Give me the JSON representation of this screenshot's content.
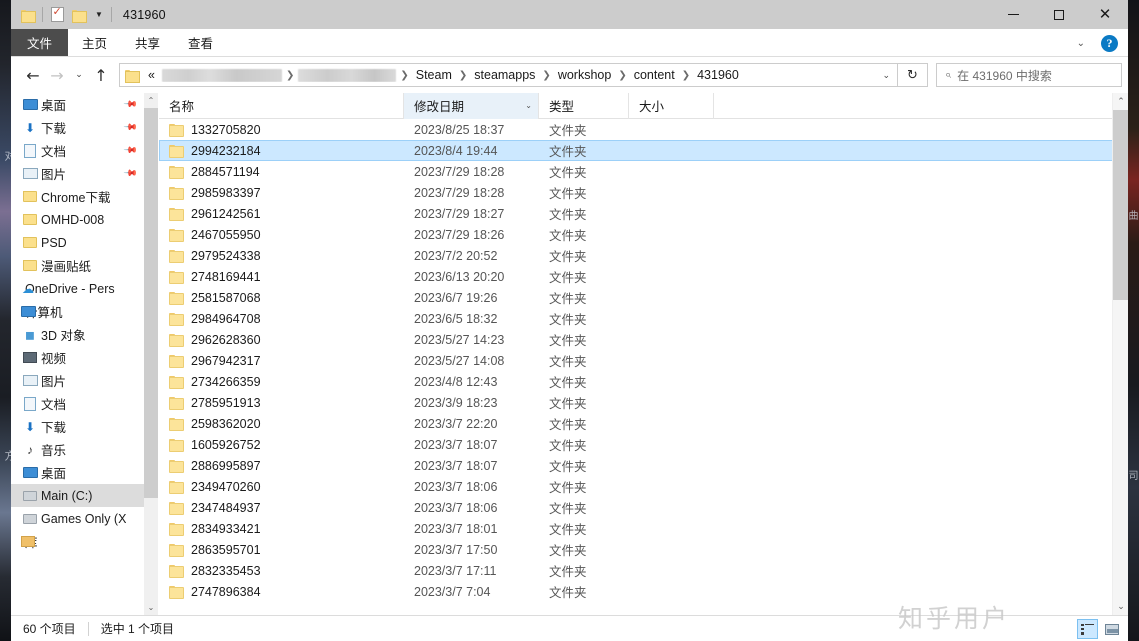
{
  "window": {
    "title": "431960",
    "quick_access": [
      "folder-icon",
      "properties-icon",
      "new-folder-icon",
      "customize-caret"
    ],
    "controls": {
      "minimize": "—",
      "maximize": "▢",
      "close": "✕"
    }
  },
  "ribbon": {
    "tabs": [
      {
        "label": "文件",
        "active": true
      },
      {
        "label": "主页",
        "active": false
      },
      {
        "label": "共享",
        "active": false
      },
      {
        "label": "查看",
        "active": false
      }
    ],
    "collapse_label": "⌄",
    "help_label": "?"
  },
  "nav": {
    "back": "←",
    "forward": "→",
    "recent": "⌄",
    "up": "↑",
    "breadcrumbs": [
      "«",
      "",
      "",
      "Steam",
      "steamapps",
      "workshop",
      "content",
      "431960"
    ],
    "dropdown": "⌄",
    "refresh": "↻"
  },
  "search": {
    "placeholder": "在 431960 中搜索",
    "icon": "search-icon"
  },
  "sidebar": {
    "items": [
      {
        "label": "桌面",
        "icon": "monitor-icon",
        "pinned": true,
        "indent": "child"
      },
      {
        "label": "下载",
        "icon": "download-icon",
        "pinned": true,
        "indent": "child"
      },
      {
        "label": "文档",
        "icon": "document-icon",
        "pinned": true,
        "indent": "child"
      },
      {
        "label": "图片",
        "icon": "pictures-icon",
        "pinned": true,
        "indent": "child"
      },
      {
        "label": "Chrome下载",
        "icon": "folder-icon",
        "pinned": false,
        "indent": "child"
      },
      {
        "label": "OMHD-008",
        "icon": "folder-icon",
        "pinned": false,
        "indent": "child"
      },
      {
        "label": "PSD",
        "icon": "folder-icon",
        "pinned": false,
        "indent": "child"
      },
      {
        "label": "漫画贴纸",
        "icon": "folder-icon",
        "pinned": false,
        "indent": "child"
      },
      {
        "label": "OneDrive - Pers",
        "icon": "cloud-icon",
        "pinned": false,
        "indent": "root"
      },
      {
        "label": "计算机",
        "icon": "computer-icon",
        "pinned": false,
        "indent": "root"
      },
      {
        "label": "3D 对象",
        "icon": "cube-icon",
        "pinned": false,
        "indent": "child"
      },
      {
        "label": "视频",
        "icon": "video-icon",
        "pinned": false,
        "indent": "child"
      },
      {
        "label": "图片",
        "icon": "pictures-icon",
        "pinned": false,
        "indent": "child"
      },
      {
        "label": "文档",
        "icon": "document-icon",
        "pinned": false,
        "indent": "child"
      },
      {
        "label": "下载",
        "icon": "download-icon",
        "pinned": false,
        "indent": "child"
      },
      {
        "label": "音乐",
        "icon": "music-icon",
        "pinned": false,
        "indent": "child"
      },
      {
        "label": "桌面",
        "icon": "monitor-icon",
        "pinned": false,
        "indent": "child"
      },
      {
        "label": "Main (C:)",
        "icon": "drive-icon",
        "pinned": false,
        "indent": "child",
        "selected": true
      },
      {
        "label": "Games Only (X",
        "icon": "drive-icon",
        "pinned": false,
        "indent": "child"
      },
      {
        "label": "库",
        "icon": "library-icon",
        "pinned": false,
        "indent": "root"
      }
    ],
    "scroll_up": "⌃",
    "scroll_down": "⌄"
  },
  "filelist": {
    "columns": [
      {
        "label": "名称",
        "key": "name",
        "sorted": false
      },
      {
        "label": "修改日期",
        "key": "date",
        "sorted": true
      },
      {
        "label": "类型",
        "key": "type",
        "sorted": false
      },
      {
        "label": "大小",
        "key": "size",
        "sorted": false
      }
    ],
    "rows": [
      {
        "name": "1332705820",
        "date": "2023/8/25 18:37",
        "type": "文件夹",
        "size": "",
        "selected": false
      },
      {
        "name": "2994232184",
        "date": "2023/8/4 19:44",
        "type": "文件夹",
        "size": "",
        "selected": true
      },
      {
        "name": "2884571194",
        "date": "2023/7/29 18:28",
        "type": "文件夹",
        "size": "",
        "selected": false
      },
      {
        "name": "2985983397",
        "date": "2023/7/29 18:28",
        "type": "文件夹",
        "size": "",
        "selected": false
      },
      {
        "name": "2961242561",
        "date": "2023/7/29 18:27",
        "type": "文件夹",
        "size": "",
        "selected": false
      },
      {
        "name": "2467055950",
        "date": "2023/7/29 18:26",
        "type": "文件夹",
        "size": "",
        "selected": false
      },
      {
        "name": "2979524338",
        "date": "2023/7/2 20:52",
        "type": "文件夹",
        "size": "",
        "selected": false
      },
      {
        "name": "2748169441",
        "date": "2023/6/13 20:20",
        "type": "文件夹",
        "size": "",
        "selected": false
      },
      {
        "name": "2581587068",
        "date": "2023/6/7 19:26",
        "type": "文件夹",
        "size": "",
        "selected": false
      },
      {
        "name": "2984964708",
        "date": "2023/6/5 18:32",
        "type": "文件夹",
        "size": "",
        "selected": false
      },
      {
        "name": "2962628360",
        "date": "2023/5/27 14:23",
        "type": "文件夹",
        "size": "",
        "selected": false
      },
      {
        "name": "2967942317",
        "date": "2023/5/27 14:08",
        "type": "文件夹",
        "size": "",
        "selected": false
      },
      {
        "name": "2734266359",
        "date": "2023/4/8 12:43",
        "type": "文件夹",
        "size": "",
        "selected": false
      },
      {
        "name": "2785951913",
        "date": "2023/3/9 18:23",
        "type": "文件夹",
        "size": "",
        "selected": false
      },
      {
        "name": "2598362020",
        "date": "2023/3/7 22:20",
        "type": "文件夹",
        "size": "",
        "selected": false
      },
      {
        "name": "1605926752",
        "date": "2023/3/7 18:07",
        "type": "文件夹",
        "size": "",
        "selected": false
      },
      {
        "name": "2886995897",
        "date": "2023/3/7 18:07",
        "type": "文件夹",
        "size": "",
        "selected": false
      },
      {
        "name": "2349470260",
        "date": "2023/3/7 18:06",
        "type": "文件夹",
        "size": "",
        "selected": false
      },
      {
        "name": "2347484937",
        "date": "2023/3/7 18:06",
        "type": "文件夹",
        "size": "",
        "selected": false
      },
      {
        "name": "2834933421",
        "date": "2023/3/7 18:01",
        "type": "文件夹",
        "size": "",
        "selected": false
      },
      {
        "name": "2863595701",
        "date": "2023/3/7 17:50",
        "type": "文件夹",
        "size": "",
        "selected": false
      },
      {
        "name": "2832335453",
        "date": "2023/3/7 17:11",
        "type": "文件夹",
        "size": "",
        "selected": false
      },
      {
        "name": "2747896384",
        "date": "2023/3/7 7:04",
        "type": "文件夹",
        "size": "",
        "selected": false
      }
    ],
    "scroll_up": "⌃",
    "scroll_down": "⌄"
  },
  "statusbar": {
    "item_count": "60 个项目",
    "selection": "选中 1 个项目",
    "view_details": "details-view-icon",
    "view_tiles": "large-icons-view-icon"
  },
  "watermark": "知乎用户",
  "colors": {
    "selection_fill": "#cce8ff",
    "selection_border": "#9cd0f8",
    "sorted_column": "#e8f1f9",
    "titlebar": "#cccccc",
    "file_tab": "#4c4c4c",
    "help_blue": "#0b7ac4",
    "folder_yellow": "#fce49a"
  }
}
